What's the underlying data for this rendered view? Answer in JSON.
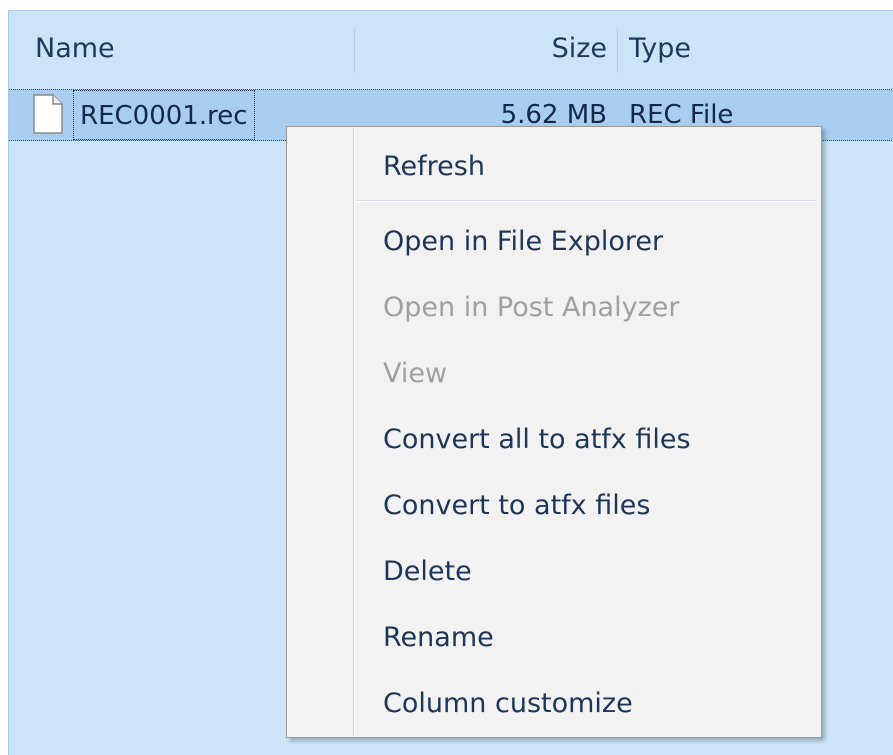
{
  "columns": {
    "name": "Name",
    "size": "Size",
    "type": "Type"
  },
  "file_row": {
    "name": "REC0001.rec",
    "size": "5.62 MB",
    "type": "REC File",
    "icon": "document-icon"
  },
  "context_menu": {
    "items": [
      {
        "label": "Refresh",
        "enabled": true
      },
      {
        "label": "Open in File Explorer",
        "enabled": true
      },
      {
        "label": "Open in Post Analyzer",
        "enabled": false
      },
      {
        "label": "View",
        "enabled": false
      },
      {
        "label": "Convert all to atfx files",
        "enabled": true
      },
      {
        "label": "Convert to atfx files",
        "enabled": true
      },
      {
        "label": "Delete",
        "enabled": true
      },
      {
        "label": "Rename",
        "enabled": true
      },
      {
        "label": "Column customize",
        "enabled": true
      }
    ]
  },
  "colors": {
    "list_background": "#cce4f7",
    "selected_row": "#a8cdee",
    "menu_background": "#f2f2f2",
    "disabled_text": "#a0a0a0"
  }
}
